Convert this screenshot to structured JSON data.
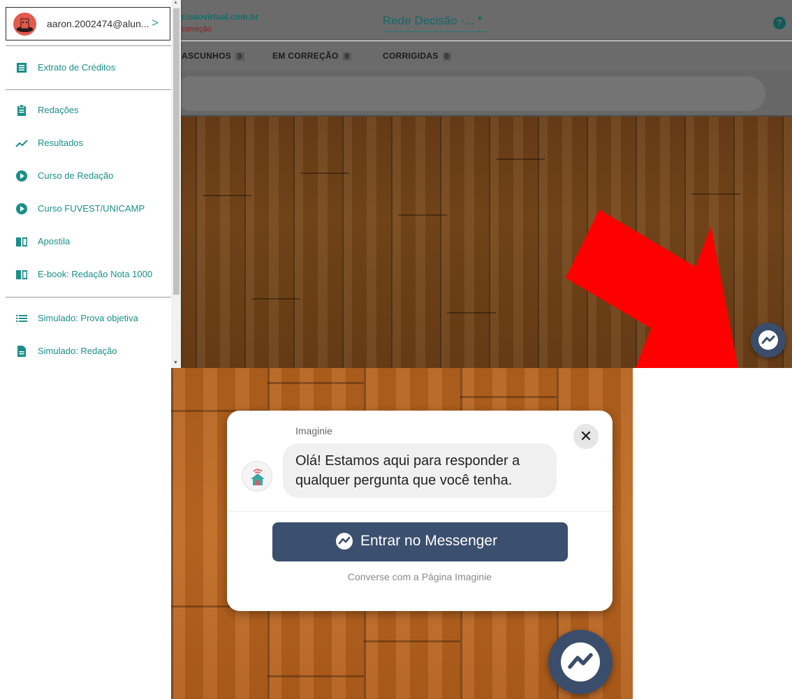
{
  "header": {
    "site_url": "cisaovirtual.com.br",
    "site_subtitle": "correção",
    "network_select": "Rede Decisão -...",
    "help_icon": "question-circle-icon"
  },
  "tabs": [
    {
      "label": "ASCUNHOS",
      "count": "0"
    },
    {
      "label": "EM CORREÇÃO",
      "count": "0"
    },
    {
      "label": "CORRIGIDAS",
      "count": "0"
    }
  ],
  "sidebar": {
    "account_email": "aaron.2002474@alun...",
    "account_chevron": ">",
    "items": [
      {
        "label": "Extrato de Créditos",
        "icon": "list-doc-icon"
      },
      {
        "label": "Redações",
        "icon": "clipboard-icon"
      },
      {
        "label": "Resultados",
        "icon": "trending-icon"
      },
      {
        "label": "Curso de Redação",
        "icon": "play-circle-icon"
      },
      {
        "label": "Curso FUVEST/UNICAMP",
        "icon": "play-circle-icon"
      },
      {
        "label": "Apostila",
        "icon": "book-icon"
      },
      {
        "label": "E-book: Redação Nota 1000",
        "icon": "book-icon"
      },
      {
        "label": "Simulado: Prova objetiva",
        "icon": "list-icon"
      },
      {
        "label": "Simulado: Redação",
        "icon": "file-icon"
      }
    ]
  },
  "popup": {
    "sender": "Imaginie",
    "message": "Olá! Estamos aqui para responder a qualquer pergunta que você tenha.",
    "button_label": "Entrar no Messenger",
    "subtitle": "Converse com a Página Imaginie",
    "close_label": "✕"
  },
  "colors": {
    "teal": "#1a8f89",
    "messenger_blue": "#3b4f6e",
    "arrow_red": "#ff0000"
  }
}
